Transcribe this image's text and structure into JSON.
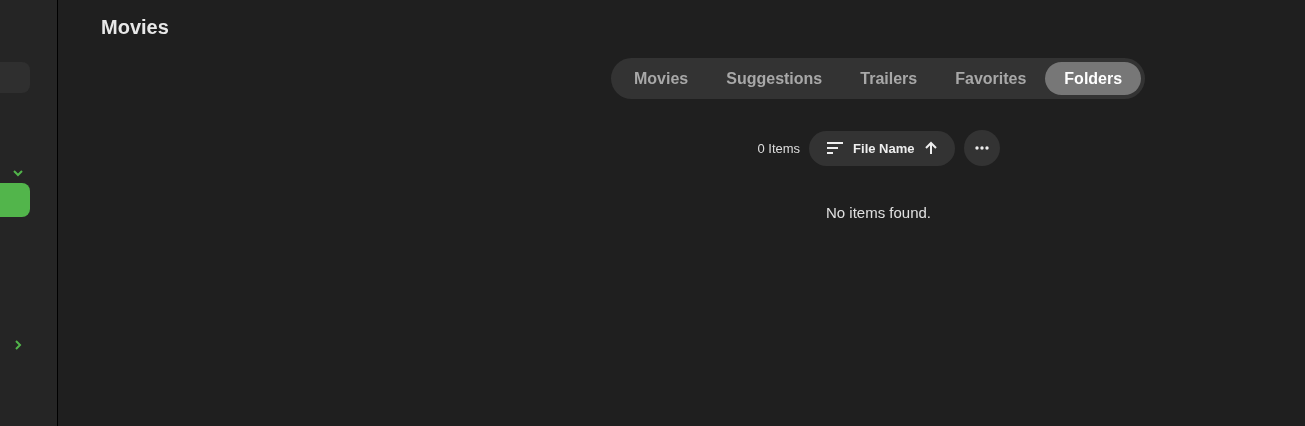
{
  "sidebar": {
    "sections": [
      {
        "expanded": true,
        "items": [
          {
            "selected": true
          }
        ]
      },
      {
        "expanded": false
      }
    ]
  },
  "page": {
    "title": "Movies"
  },
  "tabs": [
    {
      "label": "Movies",
      "selected": false
    },
    {
      "label": "Suggestions",
      "selected": false
    },
    {
      "label": "Trailers",
      "selected": false
    },
    {
      "label": "Favorites",
      "selected": false
    },
    {
      "label": "Folders",
      "selected": true
    }
  ],
  "toolbar": {
    "count": "0 Items",
    "sort": {
      "label": "File Name",
      "ascending": true
    }
  },
  "empty_message": "No items found."
}
